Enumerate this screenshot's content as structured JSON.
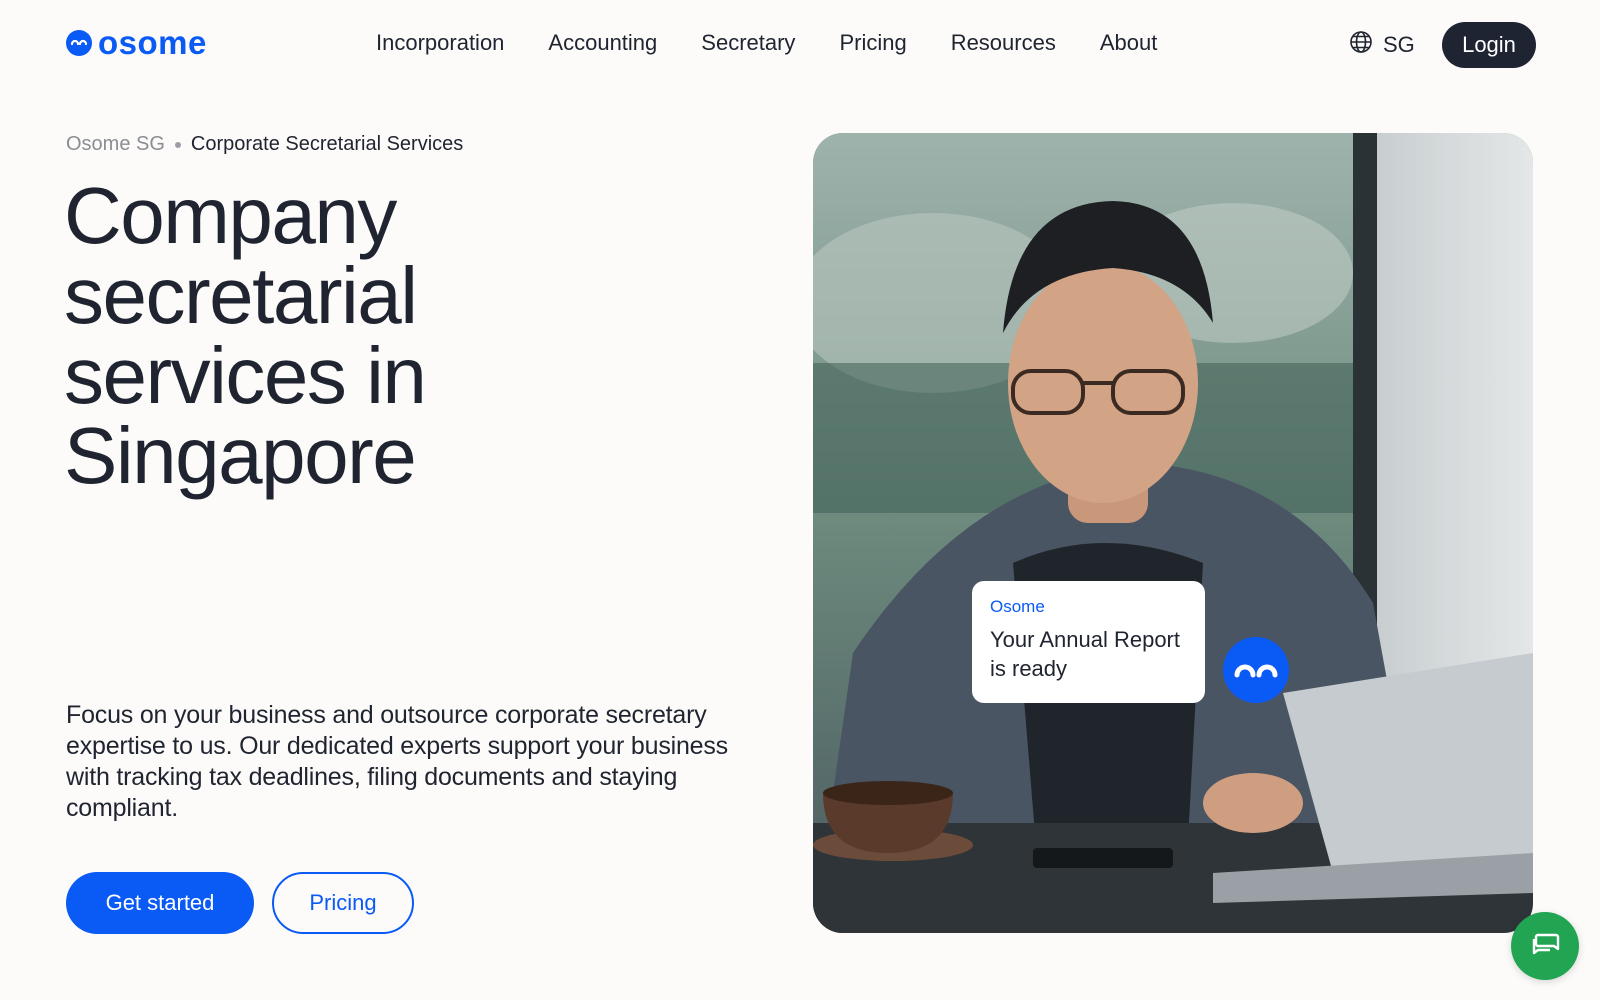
{
  "brand": {
    "name": "osome",
    "color": "#0a5af5"
  },
  "nav": {
    "items": [
      {
        "label": "Incorporation"
      },
      {
        "label": "Accounting"
      },
      {
        "label": "Secretary"
      },
      {
        "label": "Pricing"
      },
      {
        "label": "Resources"
      },
      {
        "label": "About"
      }
    ],
    "locale": "SG",
    "login_label": "Login"
  },
  "breadcrumb": {
    "home": "Osome SG",
    "current": "Corporate Secretarial Services"
  },
  "hero": {
    "title_lines": [
      "Company",
      "secretarial",
      "services in",
      "Singapore"
    ],
    "description": "Focus on your business and outsource corporate secretary expertise to us. Our dedicated experts support your business with tracking tax deadlines, filing documents and staying compliant.",
    "primary_cta": "Get started",
    "secondary_cta": "Pricing"
  },
  "notification": {
    "from": "Osome",
    "message": "Your Annual Report is ready"
  },
  "icons": {
    "locale": "globe-icon",
    "chat": "chat-icon",
    "bot": "osome-bot-icon"
  },
  "colors": {
    "accent": "#0a5af5",
    "dark": "#1f2433",
    "chat_fab": "#22a552",
    "background": "#fcfbf9"
  }
}
